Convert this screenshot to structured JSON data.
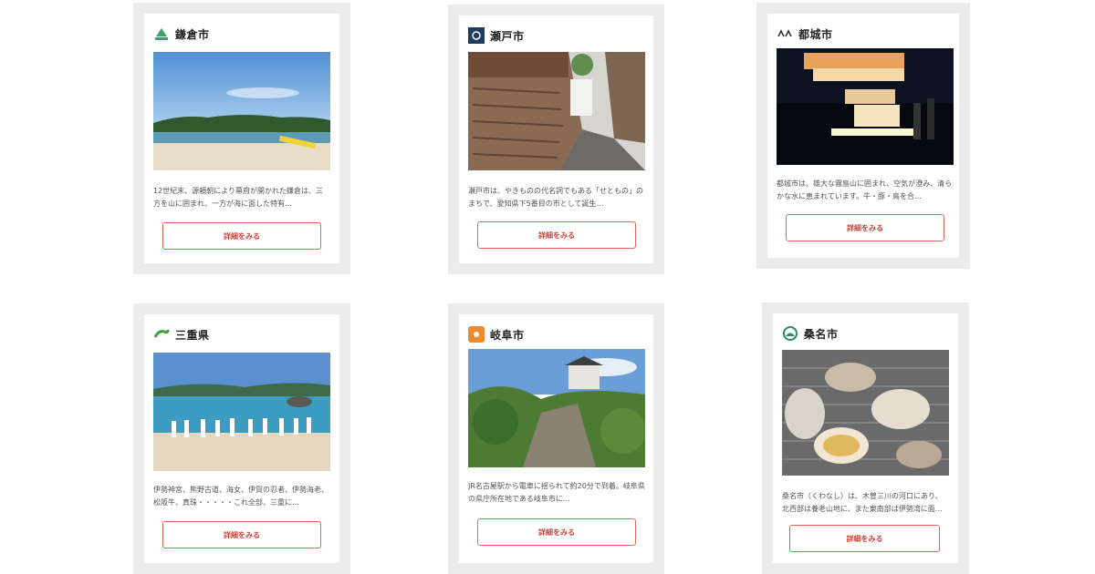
{
  "cards": [
    {
      "title": "鎌倉市",
      "logo_icon": "kamakura-emblem-icon",
      "photo": "beach-coast-photo",
      "description": "12世紀末、源頼朝により幕府が開かれた鎌倉は、三方を山に囲まれ、一方が海に面した特有…",
      "button_label": "詳細をみる"
    },
    {
      "title": "瀬戸市",
      "logo_icon": "seto-emblem-icon",
      "photo": "kiln-alley-photo",
      "description": "瀬戸市は、やきものの代名詞でもある「せともの」のまちで、愛知県下5番目の市として誕生…",
      "button_label": "詳細をみる"
    },
    {
      "title": "都城市",
      "logo_icon": "miyakonojo-emblem-icon",
      "photo": "night-lanterns-photo",
      "description": "都城市は、雄大な霧島山に囲まれ、空気が澄み、清らかな水に恵まれています。牛・豚・鳥を合…",
      "button_label": "詳細をみる"
    },
    {
      "title": "三重県",
      "logo_icon": "mie-emblem-icon",
      "photo": "ama-divers-beach-photo",
      "description": "伊勢神宮、熊野古道、海女、伊賀の忍者、伊勢海老、松阪牛、真珠・・・・・これ全部、三重に…",
      "button_label": "詳細をみる"
    },
    {
      "title": "岐阜市",
      "logo_icon": "gifu-emblem-icon",
      "photo": "gifu-castle-photo",
      "description": "JR名古屋駅から電車に揺られて約20分で到着。岐阜県の県庁所在地である岐阜市に…",
      "button_label": "詳細をみる"
    },
    {
      "title": "桑名市",
      "logo_icon": "kuwana-emblem-icon",
      "photo": "grilled-clams-photo",
      "description": "桑名市（くわなし）は、木曽三川の河口にあり、北西部は養老山地に、また東南部は伊勢湾に面…",
      "button_label": "詳細をみる"
    }
  ],
  "colors": {
    "card_frame": "#ececec",
    "button_border": "#d96b60",
    "button_text": "#c8463b"
  }
}
